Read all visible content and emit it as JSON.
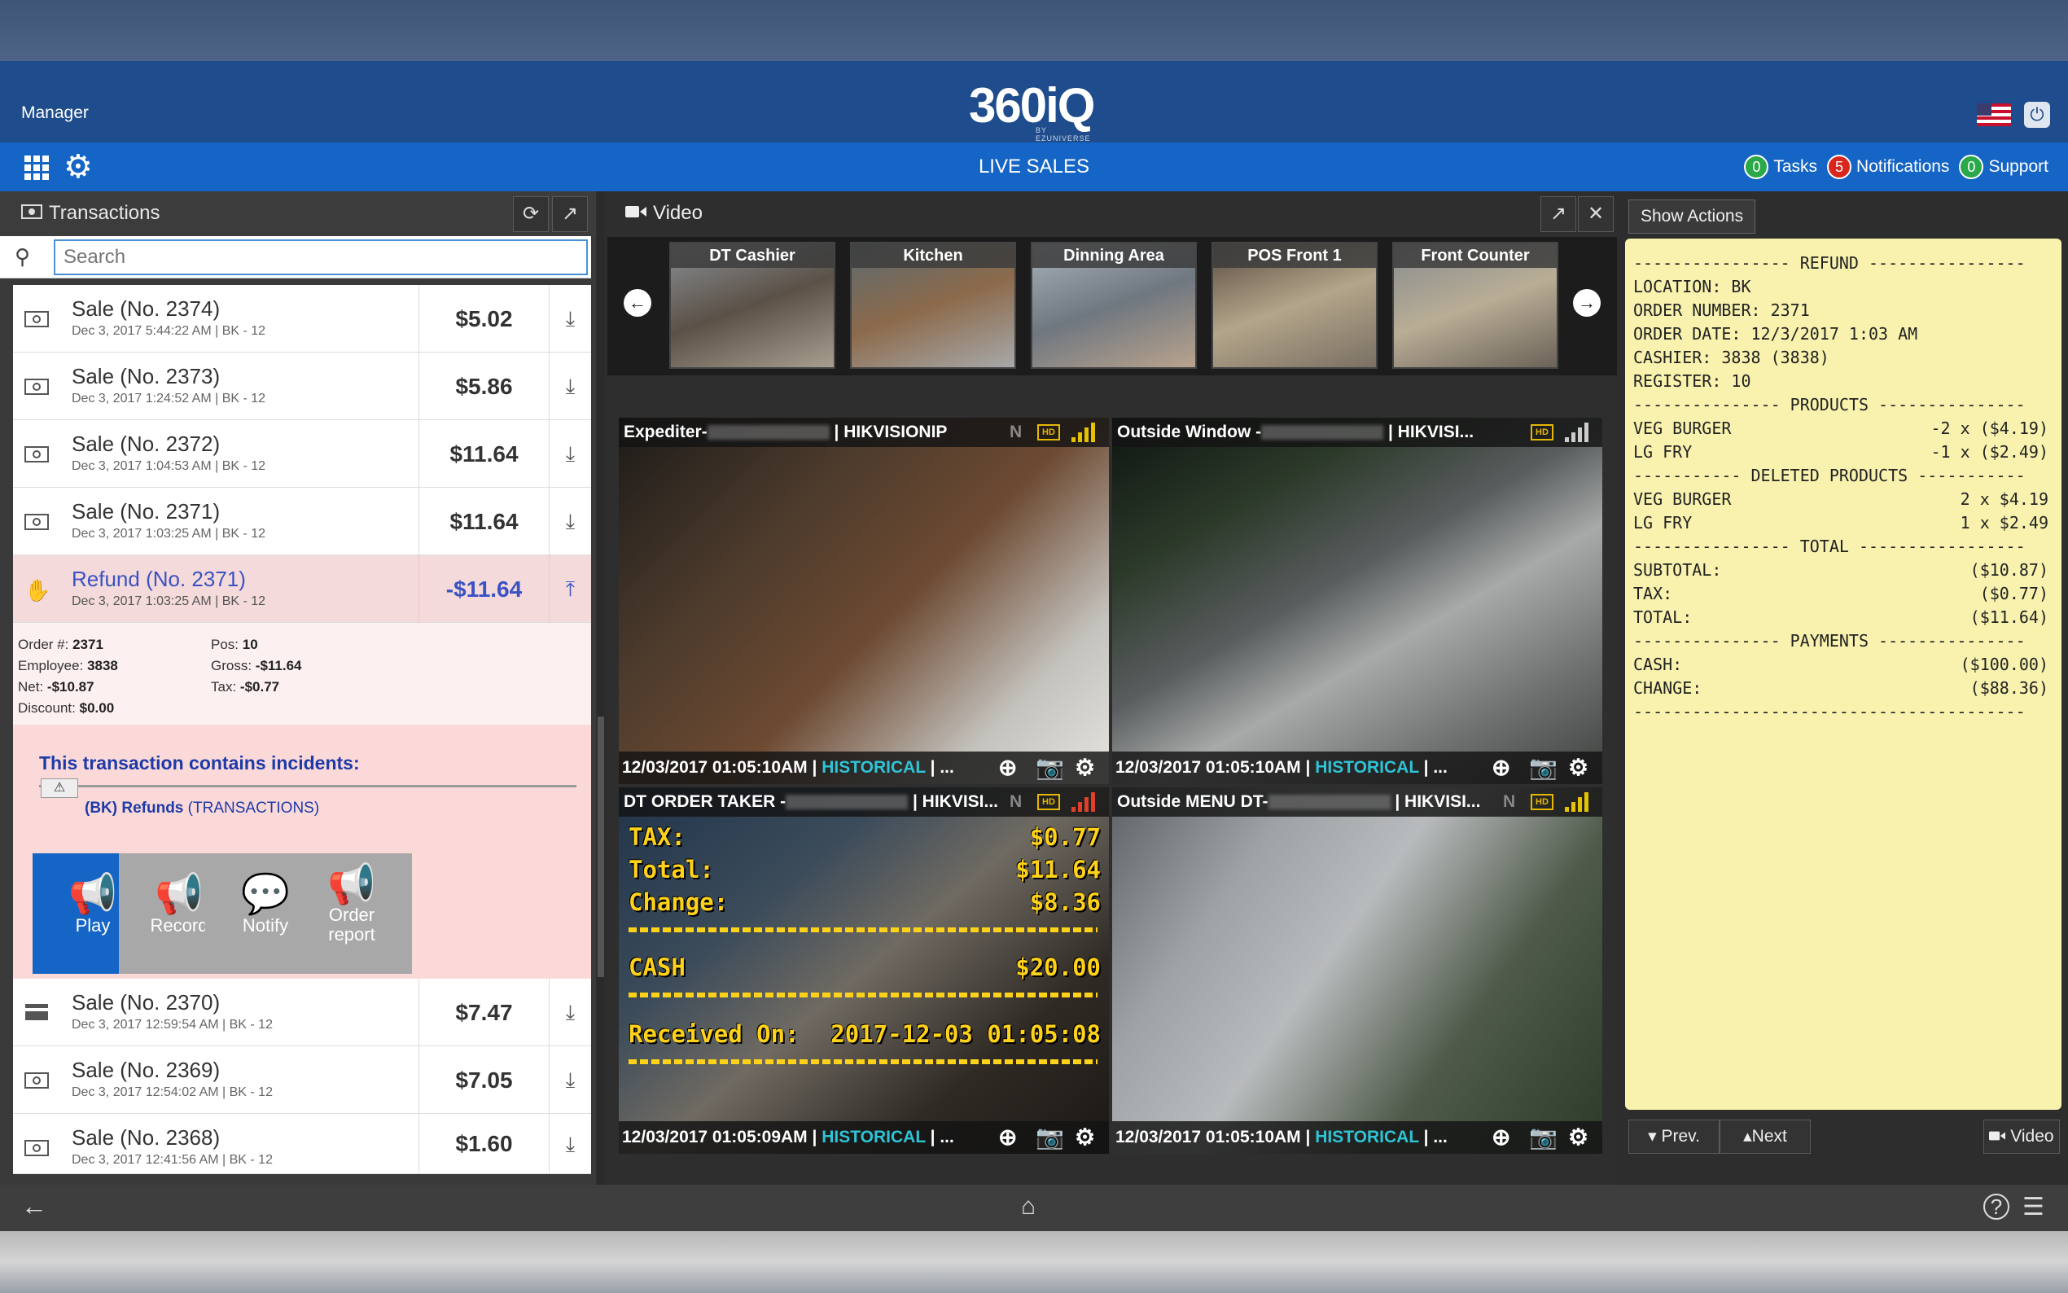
{
  "header": {
    "user_label": "Manager",
    "logo_text": "360iQ",
    "logo_sub": "BY EZUNIVERSE",
    "page_title": "LIVE SALES",
    "links": [
      {
        "count": "0",
        "label": "Tasks",
        "color": "#2aa84a"
      },
      {
        "count": "5",
        "label": "Notifications",
        "color": "#d9261c"
      },
      {
        "count": "0",
        "label": "Support",
        "color": "#2aa84a"
      }
    ]
  },
  "transactions": {
    "title": "Transactions",
    "search_placeholder": "Search",
    "items": [
      {
        "name": "Sale (No. 2374)",
        "sub": "Dec 3, 2017 5:44:22 AM | BK - 12",
        "amount": "$5.02"
      },
      {
        "name": "Sale (No. 2373)",
        "sub": "Dec 3, 2017 1:24:52 AM | BK - 12",
        "amount": "$5.86"
      },
      {
        "name": "Sale (No. 2372)",
        "sub": "Dec 3, 2017 1:04:53 AM | BK - 12",
        "amount": "$11.64"
      },
      {
        "name": "Sale (No. 2371)",
        "sub": "Dec 3, 2017 1:03:25 AM | BK - 12",
        "amount": "$11.64"
      }
    ],
    "selected": {
      "name": "Refund (No. 2371)",
      "sub": "Dec 3, 2017 1:03:25 AM | BK - 12",
      "amount": "-$11.64",
      "details": {
        "order_label": "Order #:",
        "order": "2371",
        "employee_label": "Employee:",
        "employee": "3838",
        "net_label": "Net:",
        "net": "-$10.87",
        "discount_label": "Discount:",
        "discount": "$0.00",
        "pos_label": "Pos:",
        "pos": "10",
        "gross_label": "Gross:",
        "gross": "-$11.64",
        "tax_label": "Tax:",
        "tax": "-$0.77"
      },
      "incidents_title": "This transaction contains incidents:",
      "incident_bold": "(BK) Refunds",
      "incident_rest": " (TRANSACTIONS)",
      "actions": [
        "Play",
        "Record",
        "Notify",
        "Order report"
      ]
    },
    "items_after": [
      {
        "name": "Sale (No. 2370)",
        "sub": "Dec 3, 2017 12:59:54 AM | BK - 12",
        "amount": "$7.47"
      },
      {
        "name": "Sale (No. 2369)",
        "sub": "Dec 3, 2017 12:54:02 AM | BK - 12",
        "amount": "$7.05"
      },
      {
        "name": "Sale (No. 2368)",
        "sub": "Dec 3, 2017 12:41:56 AM | BK - 12",
        "amount": "$1.60"
      }
    ]
  },
  "video": {
    "title": "Video",
    "thumbnails": [
      "DT Cashier",
      "Kitchen",
      "Dinning Area",
      "POS Front 1",
      "Front Counter"
    ],
    "cameras": [
      {
        "name": "Expediter-",
        "suffix": " | HIKVISIONIP",
        "n": "N",
        "time": "12/03/2017 01:05:10AM",
        "mode": "HISTORICAL"
      },
      {
        "name": "Outside Window -",
        "suffix": " | HIKVISI...",
        "n": "",
        "time": "12/03/2017 01:05:10AM",
        "mode": "HISTORICAL"
      },
      {
        "name": "DT ORDER TAKER -",
        "suffix": " | HIKVISI...",
        "n": "N",
        "time": "12/03/2017 01:05:09AM",
        "mode": "HISTORICAL"
      },
      {
        "name": "Outside MENU DT-",
        "suffix": " | HIKVISI...",
        "n": "N",
        "time": "12/03/2017 01:05:10AM",
        "mode": "HISTORICAL"
      }
    ],
    "overlay": {
      "tax_label": "TAX:",
      "tax": "$0.77",
      "total_label": "Total:",
      "total": "$11.64",
      "change_label": "Change:",
      "change": "$8.36",
      "cash_label": "CASH",
      "cash": "$20.00",
      "received_label": "Received On:",
      "received": "2017-12-03 01:05:08"
    }
  },
  "receipt": {
    "show_actions": "Show Actions",
    "lines": [
      {
        "l": "---------------- REFUND ----------------",
        "r": ""
      },
      {
        "l": "LOCATION: BK",
        "r": ""
      },
      {
        "l": "ORDER NUMBER: 2371",
        "r": ""
      },
      {
        "l": "ORDER DATE: 12/3/2017 1:03 AM",
        "r": ""
      },
      {
        "l": "CASHIER: 3838 (3838)",
        "r": ""
      },
      {
        "l": "REGISTER: 10",
        "r": ""
      },
      {
        "l": "--------------- PRODUCTS ---------------",
        "r": ""
      },
      {
        "l": "VEG BURGER",
        "r": "-2 x ($4.19)"
      },
      {
        "l": "LG FRY",
        "r": "-1 x ($2.49)"
      },
      {
        "l": "----------- DELETED PRODUCTS -----------",
        "r": ""
      },
      {
        "l": "VEG BURGER",
        "r": "2 x $4.19"
      },
      {
        "l": "LG FRY",
        "r": "1 x $2.49"
      },
      {
        "l": "---------------- TOTAL -----------------",
        "r": ""
      },
      {
        "l": "SUBTOTAL:",
        "r": "($10.87)"
      },
      {
        "l": "TAX:",
        "r": "($0.77)"
      },
      {
        "l": "TOTAL:",
        "r": "($11.64)"
      },
      {
        "l": "--------------- PAYMENTS ---------------",
        "r": ""
      },
      {
        "l": "CASH:",
        "r": "($100.00)"
      },
      {
        "l": "CHANGE:",
        "r": "($88.36)"
      },
      {
        "l": "----------------------------------------",
        "r": ""
      }
    ],
    "prev": "Prev.",
    "next": "Next",
    "video_btn": "Video"
  }
}
